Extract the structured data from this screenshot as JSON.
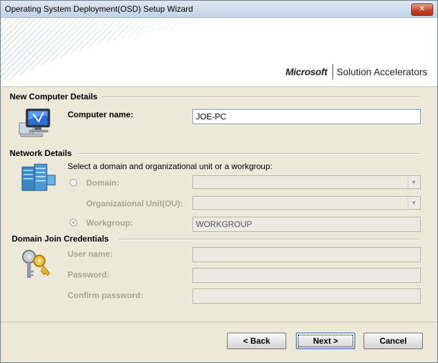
{
  "window": {
    "title": "Operating System Deployment(OSD) Setup Wizard",
    "close_label": "✕"
  },
  "banner": {
    "brand": "Microsoft",
    "product": "Solution Accelerators"
  },
  "sections": {
    "computer": {
      "heading": "New Computer Details",
      "computer_name_label": "Computer name:",
      "computer_name_value": "JOE-PC"
    },
    "network": {
      "heading": "Network Details",
      "instruction": "Select a domain and organizational unit or a workgroup:",
      "domain_label": "Domain:",
      "domain_value": "",
      "ou_label": "Organizational Unit(OU):",
      "ou_value": "",
      "workgroup_label": "Workgroup:",
      "workgroup_value": "WORKGROUP",
      "selected": "workgroup"
    },
    "credentials": {
      "heading": "Domain Join Credentials",
      "username_label": "User name:",
      "username_value": "",
      "password_label": "Password:",
      "password_value": "",
      "confirm_label": "Confirm password:",
      "confirm_value": ""
    }
  },
  "buttons": {
    "back": "< Back",
    "next": "Next >",
    "cancel": "Cancel"
  },
  "icons": {
    "computer": "computer-monitor-icon",
    "network": "server-network-icon",
    "credentials": "keys-icon"
  },
  "colors": {
    "dialog_bg": "#ece9d8",
    "close_button": "#c23f26",
    "field_border": "#7f9db9",
    "disabled_text": "#a8a496"
  }
}
